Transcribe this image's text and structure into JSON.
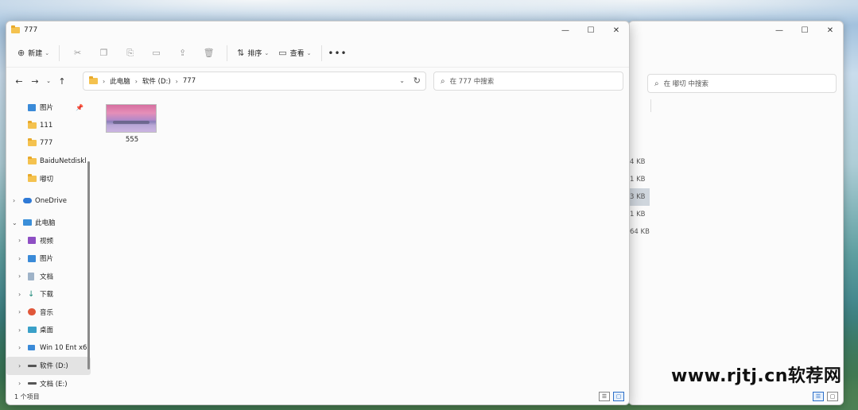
{
  "front_window": {
    "title": "777",
    "toolbar": {
      "new_label": "新建",
      "sort_label": "排序",
      "view_label": "查看",
      "more_label": "•••"
    },
    "address": {
      "crumbs": [
        "此电脑",
        "软件 (D:)",
        "777"
      ]
    },
    "search": {
      "placeholder": "在 777 中搜索"
    },
    "sidebar": {
      "quick_access": [
        {
          "label": "图片",
          "icon": "pictures-icon",
          "pinned": true
        },
        {
          "label": "111",
          "icon": "folder-icon"
        },
        {
          "label": "777",
          "icon": "folder-icon"
        },
        {
          "label": "BaiduNetdiskl",
          "icon": "folder-icon"
        },
        {
          "label": "嘟切",
          "icon": "folder-icon"
        }
      ],
      "onedrive": {
        "label": "OneDrive",
        "icon": "cloud-icon"
      },
      "this_pc": {
        "label": "此电脑",
        "icon": "computer-icon"
      },
      "pc_items": [
        {
          "label": "视频",
          "icon": "videos-icon"
        },
        {
          "label": "图片",
          "icon": "pictures-icon"
        },
        {
          "label": "文档",
          "icon": "documents-icon"
        },
        {
          "label": "下载",
          "icon": "download-icon"
        },
        {
          "label": "音乐",
          "icon": "music-icon"
        },
        {
          "label": "桌面",
          "icon": "desktop-icon"
        },
        {
          "label": "Win 10 Ent x6",
          "icon": "windows-drive-icon"
        },
        {
          "label": "软件 (D:)",
          "icon": "drive-icon",
          "selected": true
        },
        {
          "label": "文档 (E:)",
          "icon": "drive-icon"
        }
      ]
    },
    "files": [
      {
        "name": "555",
        "type": "image"
      }
    ],
    "status": "1 个项目"
  },
  "back_window": {
    "search": {
      "placeholder": "在 嘟切 中搜索"
    },
    "sizes": [
      "4 KB",
      "1 KB",
      "3 KB",
      "1 KB",
      "64 KB"
    ]
  },
  "watermark": "www.rjtj.cn软荐网",
  "window_controls": {
    "minimize": "—",
    "maximize": "☐",
    "close": "✕"
  }
}
